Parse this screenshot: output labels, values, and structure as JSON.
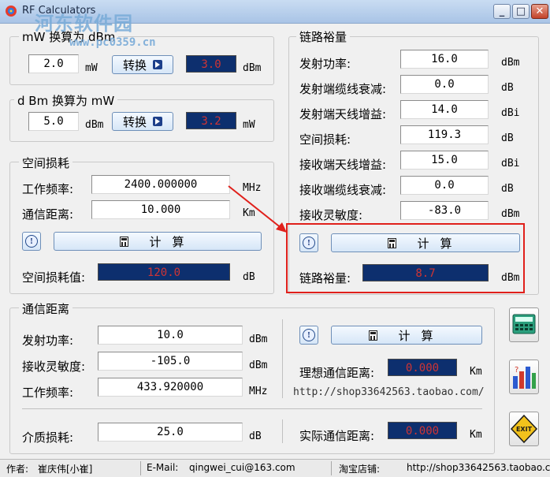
{
  "window": {
    "title": "RF Calculators"
  },
  "watermark": {
    "line1": "河东软件园",
    "line2": "www.pc0359.cn"
  },
  "mw_to_dbm": {
    "title": "mW 换算为 dBm",
    "input_value": "2.0",
    "input_unit": "mW",
    "button_label": "转换",
    "output_value": "3.0",
    "output_unit": "dBm"
  },
  "dbm_to_mw": {
    "title": "d Bm 换算为 mW",
    "input_value": "5.0",
    "input_unit": "dBm",
    "button_label": "转换",
    "output_value": "3.2",
    "output_unit": "mW"
  },
  "space_loss": {
    "title": "空间损耗",
    "freq_label": "工作频率:",
    "freq_value": "2400.000000",
    "freq_unit": "MHz",
    "dist_label": "通信距离:",
    "dist_value": "10.000",
    "dist_unit": "Km",
    "calc_label": "计算",
    "result_label": "空间损耗值:",
    "result_value": "120.0",
    "result_unit": "dB"
  },
  "link_margin": {
    "title": "链路裕量",
    "rows": [
      {
        "label": "发射功率:",
        "value": "16.0",
        "unit": "dBm"
      },
      {
        "label": "发射端缆线衰减:",
        "value": "0.0",
        "unit": "dB"
      },
      {
        "label": "发射端天线增益:",
        "value": "14.0",
        "unit": "dBi"
      },
      {
        "label": "空间损耗:",
        "value": "119.3",
        "unit": "dB"
      },
      {
        "label": "接收端天线增益:",
        "value": "15.0",
        "unit": "dBi"
      },
      {
        "label": "接收端缆线衰减:",
        "value": "0.0",
        "unit": "dB"
      },
      {
        "label": "接收灵敏度:",
        "value": "-83.0",
        "unit": "dBm"
      }
    ],
    "calc_label": "计算",
    "result_label": "链路裕量:",
    "result_value": "8.7",
    "result_unit": "dBm"
  },
  "comm_distance": {
    "title": "通信距离",
    "tx_label": "发射功率:",
    "tx_value": "10.0",
    "tx_unit": "dBm",
    "rx_label": "接收灵敏度:",
    "rx_value": "-105.0",
    "rx_unit": "dBm",
    "freq_label": "工作频率:",
    "freq_value": "433.920000",
    "freq_unit": "MHz",
    "medium_label": "介质损耗:",
    "medium_value": "25.0",
    "medium_unit": "dB",
    "calc_label": "计算",
    "ideal_label": "理想通信距离:",
    "ideal_value": "0.000",
    "ideal_unit": "Km",
    "actual_label": "实际通信距离:",
    "actual_value": "0.000",
    "actual_unit": "Km",
    "url": "http://shop33642563.taobao.com/"
  },
  "statusbar": {
    "author_label": "作者:",
    "author": "崔庆伟[小崔]",
    "email_label": "E-Mail:",
    "email": "qingwei_cui@163.com",
    "shop_label": "淘宝店铺:",
    "shop": "http://shop33642563.taobao.c"
  },
  "colors": {
    "result_bg": "#0d2f6e",
    "result_text": "#cf3434",
    "highlight": "#e0201b",
    "arrow": "#e0201b"
  },
  "icons": [
    "app-logo-icon",
    "arrow-right-icon",
    "calculator-icon",
    "help-icon",
    "calculator-tool-icon",
    "chart-tool-icon",
    "exit-icon"
  ]
}
